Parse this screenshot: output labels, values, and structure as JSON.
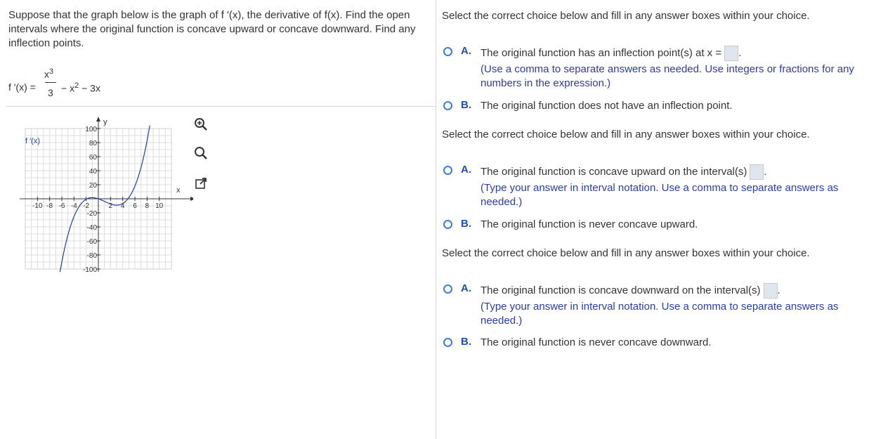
{
  "question": {
    "text": "Suppose that the graph below is the graph of f ′(x), the derivative of f(x). Find the open intervals where the original function is concave upward or concave downward. Find any inflection points.",
    "eq_lhs": "f ′(x) =",
    "eq_num": "x",
    "eq_num_exp": "3",
    "eq_den": "3",
    "eq_rest_a": "− x",
    "eq_rest_exp": "2",
    "eq_rest_b": " − 3x"
  },
  "graph": {
    "function_label": "f ′(x)",
    "y_axis_label": "y",
    "x_axis_label": "x",
    "x_ticks": [
      "-10",
      "-8",
      "-6",
      "-4",
      "-2",
      "2",
      "4",
      "6",
      "8",
      "10"
    ],
    "y_ticks": [
      "100",
      "80",
      "60",
      "40",
      "20",
      "-20",
      "-40",
      "-60",
      "-80",
      "-100"
    ],
    "curve_color": "#1f3fa6"
  },
  "tools": {
    "zoom_in": "zoom-in-icon",
    "zoom_out": "zoom-out-icon",
    "popout": "external-link-icon"
  },
  "parts": [
    {
      "instruction": "Select the correct choice below and fill in any answer boxes within your choice.",
      "option_a_letter": "A.",
      "option_a_text": "The original function has an inflection point(s) at x =",
      "option_a_hint": "(Use a comma to separate answers as needed. Use integers or fractions for any numbers in the expression.)",
      "option_b_letter": "B.",
      "option_b_text": "The original function does not have an inflection point."
    },
    {
      "instruction": "Select the correct choice below and fill in any answer boxes within your choice.",
      "option_a_letter": "A.",
      "option_a_text": "The original function is concave upward on the interval(s)",
      "option_a_hint": "(Type your answer in interval notation. Use a comma to separate answers as needed.)",
      "option_b_letter": "B.",
      "option_b_text": "The original function is never concave upward."
    },
    {
      "instruction": "Select the correct choice below and fill in any answer boxes within your choice.",
      "option_a_letter": "A.",
      "option_a_text": "The original function is concave downward on the interval(s)",
      "option_a_hint": "(Type your answer in interval notation. Use a comma to separate answers as needed.)",
      "option_b_letter": "B.",
      "option_b_text": "The original function is never concave downward."
    }
  ]
}
